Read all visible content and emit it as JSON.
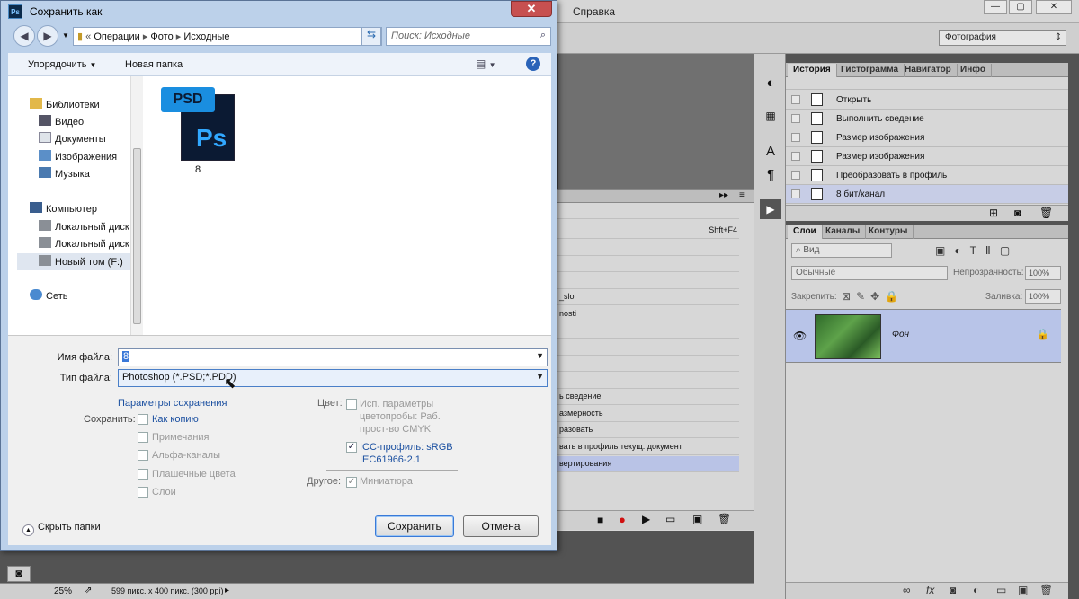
{
  "photoshop": {
    "menu_help": "Справка",
    "workspace": "Фотография",
    "status_zoom": "25%",
    "status_info": "599 пикс. x 400 пикс. (300 ppi)",
    "history_panel": {
      "tabs": [
        "История",
        "Гистограмма",
        "Навигатор",
        "Инфо"
      ],
      "items": [
        "Открыть",
        "Выполнить сведение",
        "Размер изображения",
        "Размер изображения",
        "Преобразовать в профиль",
        "8 бит/канал"
      ]
    },
    "layers_panel": {
      "tabs": [
        "Слои",
        "Каналы",
        "Контуры"
      ],
      "filter_kind": "Вид",
      "blend_mode": "Обычные",
      "opacity_label": "Непрозрачность:",
      "opacity_value": "100%",
      "lock_label": "Закрепить:",
      "fill_label": "Заливка:",
      "fill_value": "100%",
      "layer_name": "Фон"
    },
    "actions_panel": {
      "shortcut": "Shft+F4",
      "items": [
        "_sloi",
        "nosti",
        "ь сведение",
        "азмерность",
        "разовать",
        "вать в профиль текущ. документ",
        "вертирования"
      ]
    }
  },
  "dialog": {
    "title": "Сохранить как",
    "close_glyph": "✕",
    "breadcrumb": [
      "Операции",
      "Фото",
      "Исходные"
    ],
    "search_placeholder": "Поиск: Исходные",
    "organize": "Упорядочить",
    "new_folder": "Новая папка",
    "nav": {
      "libraries": "Библиотеки",
      "video": "Видео",
      "documents": "Документы",
      "images": "Изображения",
      "music": "Музыка",
      "computer": "Компьютер",
      "local1": "Локальный диск",
      "local2": "Локальный диск",
      "new_volume": "Новый том (F:)",
      "network": "Сеть"
    },
    "file_item": {
      "label": "8",
      "icon_top": "PSD",
      "icon_main": "Ps"
    },
    "filename_label": "Имя файла:",
    "filename_value": "8",
    "filetype_label": "Тип файла:",
    "filetype_value": "Photoshop (*.PSD;*.PDD)",
    "save_options_link": "Параметры сохранения",
    "save_label": "Сохранить:",
    "as_copy": "Как копию",
    "notes": "Примечания",
    "alpha": "Альфа-каналы",
    "spot": "Плашечные цвета",
    "layers": "Слои",
    "color_label": "Цвет:",
    "proof_setup": "Исп. параметры цветопробы: Раб. прост-во CMYK",
    "icc_profile": "ICC-профиль: sRGB IEC61966-2.1",
    "other_label": "Другое:",
    "thumbnail": "Миниатюра",
    "hide_folders": "Скрыть папки",
    "save_button": "Сохранить",
    "cancel_button": "Отмена"
  }
}
